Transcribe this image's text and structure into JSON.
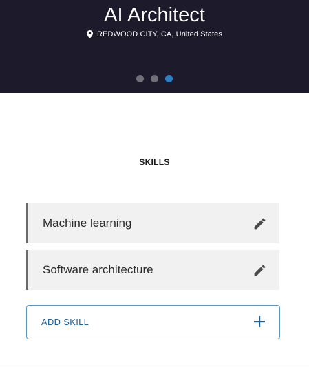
{
  "header": {
    "title": "AI Architect",
    "location": "REDWOOD CITY, CA, United States",
    "pager": {
      "count": 3,
      "active_index": 2
    }
  },
  "skills": {
    "title": "SKILLS",
    "items": [
      {
        "label": "Machine learning"
      },
      {
        "label": "Software architecture"
      }
    ],
    "add_label": "ADD SKILL"
  },
  "icons": {
    "location": "map-pin-icon",
    "edit": "pencil-icon",
    "add": "plus-icon"
  },
  "colors": {
    "header_bg": "#1d1b2b",
    "accent": "#2c80c4",
    "add_border": "#5a95c2"
  }
}
